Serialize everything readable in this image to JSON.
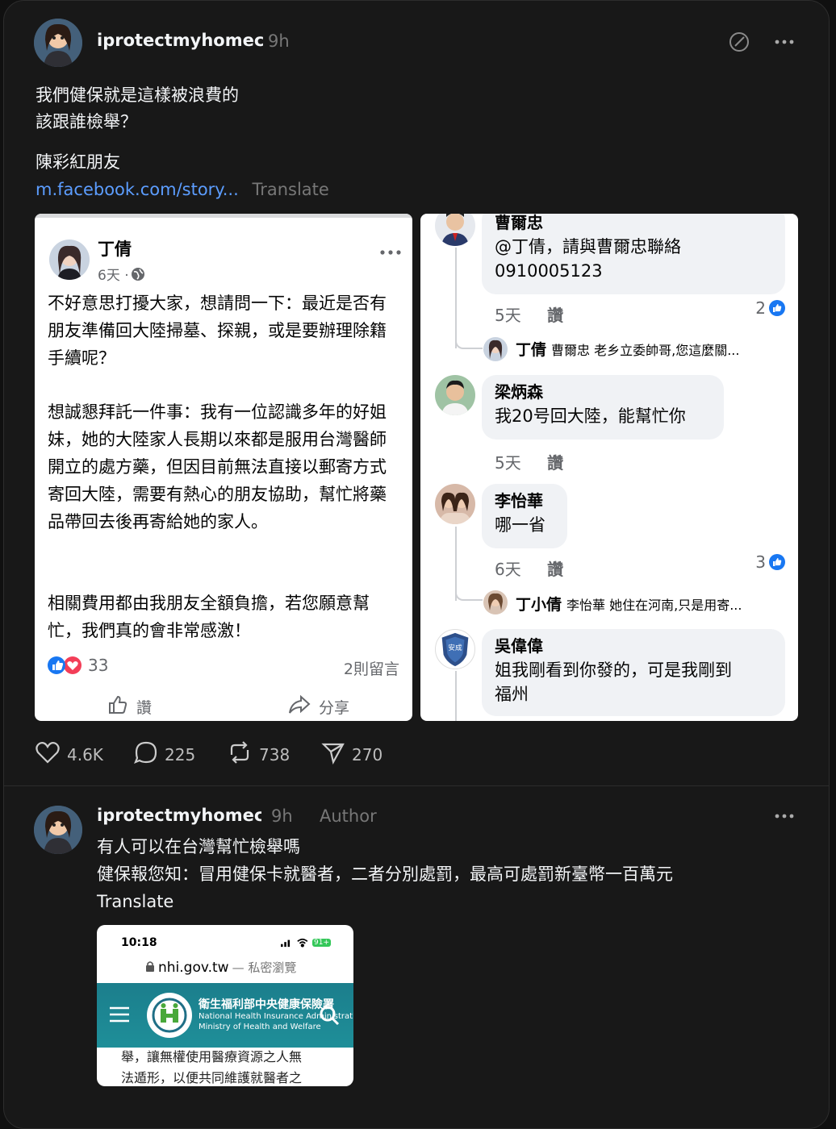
{
  "post": {
    "username": "iprotectmyhomec",
    "time": "9h",
    "text_line1": "我們健保就是這樣被浪費的",
    "text_line2": "該跟誰檢舉？",
    "text_line3": "陳彩紅朋友",
    "link": "m.facebook.com/story...",
    "translate": "Translate",
    "stats": {
      "likes": "4.6K",
      "comments": "225",
      "reposts": "738",
      "shares": "270"
    }
  },
  "fb_post": {
    "author": "丁倩",
    "meta": "6天 · ",
    "para1": "不好意思打擾大家，想請問一下：最近是否有朋友準備回大陸掃墓、探親，或是要辦理除籍手續呢？",
    "para2": "想誠懇拜託一件事：我有一位認識多年的好姐妹，她的大陸家人長期以來都是服用台灣醫師開立的處方藥，但因目前無法直接以郵寄方式寄回大陸，需要有熱心的朋友協助，幫忙將藥品帶回去後再寄給她的家人。",
    "para3": "相關費用都由我朋友全額負擔，若您願意幫忙，我們真的會非常感激！",
    "reactions": "33",
    "comments": "2則留言",
    "like_label": "讚",
    "share_label": "分享"
  },
  "fb_comments": [
    {
      "name": "曹爾忠",
      "text1": "@丁倩，請與曹爾忠聯絡",
      "text2": "0910005123",
      "time": "5天",
      "like": "讚",
      "count": "2",
      "reply": {
        "name": "丁倩",
        "text": "曹爾忠 老乡立委帥哥,您這麼關..."
      }
    },
    {
      "name": "梁炳森",
      "text1": "我20号回大陸，能幫忙你",
      "time": "5天",
      "like": "讚"
    },
    {
      "name": "李怡華",
      "text1": "哪一省",
      "time": "6天",
      "like": "讚",
      "count": "3",
      "reply": {
        "name": "丁小倩",
        "text": "李怡華 她住在河南,只是用寄..."
      }
    },
    {
      "name": "吳偉偉",
      "text1": "姐我剛看到你發的，可是我剛到",
      "text2": "福州",
      "avatar_text": "安成"
    }
  ],
  "reply_post": {
    "username": "iprotectmyhomec",
    "time": "9h",
    "author_label": "Author",
    "line1": "有人可以在台灣幫忙檢舉嗎",
    "line2": "健保報您知：冒用健保卡就醫者，二者分別處罰，最高可處罰新臺幣一百萬元",
    "translate": "Translate"
  },
  "phone_shot": {
    "clock": "10:18",
    "battery": "91+",
    "url": "nhi.gov.tw",
    "url_suffix": " — 私密瀏覽",
    "org_cn": "衛生福利部中央健康保險署",
    "org_en1": "National Health Insurance Administration,",
    "org_en2": "Ministry of Health and Welfare",
    "body1": "舉，讓無權使用醫療資源之人無",
    "body2": "法遁形，以便共同維護就醫者之"
  },
  "icons": [
    "edit-icon",
    "more-icon",
    "globe-icon",
    "heart-icon",
    "comment-icon",
    "repost-icon",
    "share-icon",
    "like-icon",
    "fb-share-icon",
    "search-icon",
    "menu-icon",
    "lock-icon"
  ],
  "colors": {
    "background": "#181818",
    "link": "#5c9dff",
    "fb_blue": "#1877f2",
    "nhi_teal": "#1b7e8c"
  }
}
